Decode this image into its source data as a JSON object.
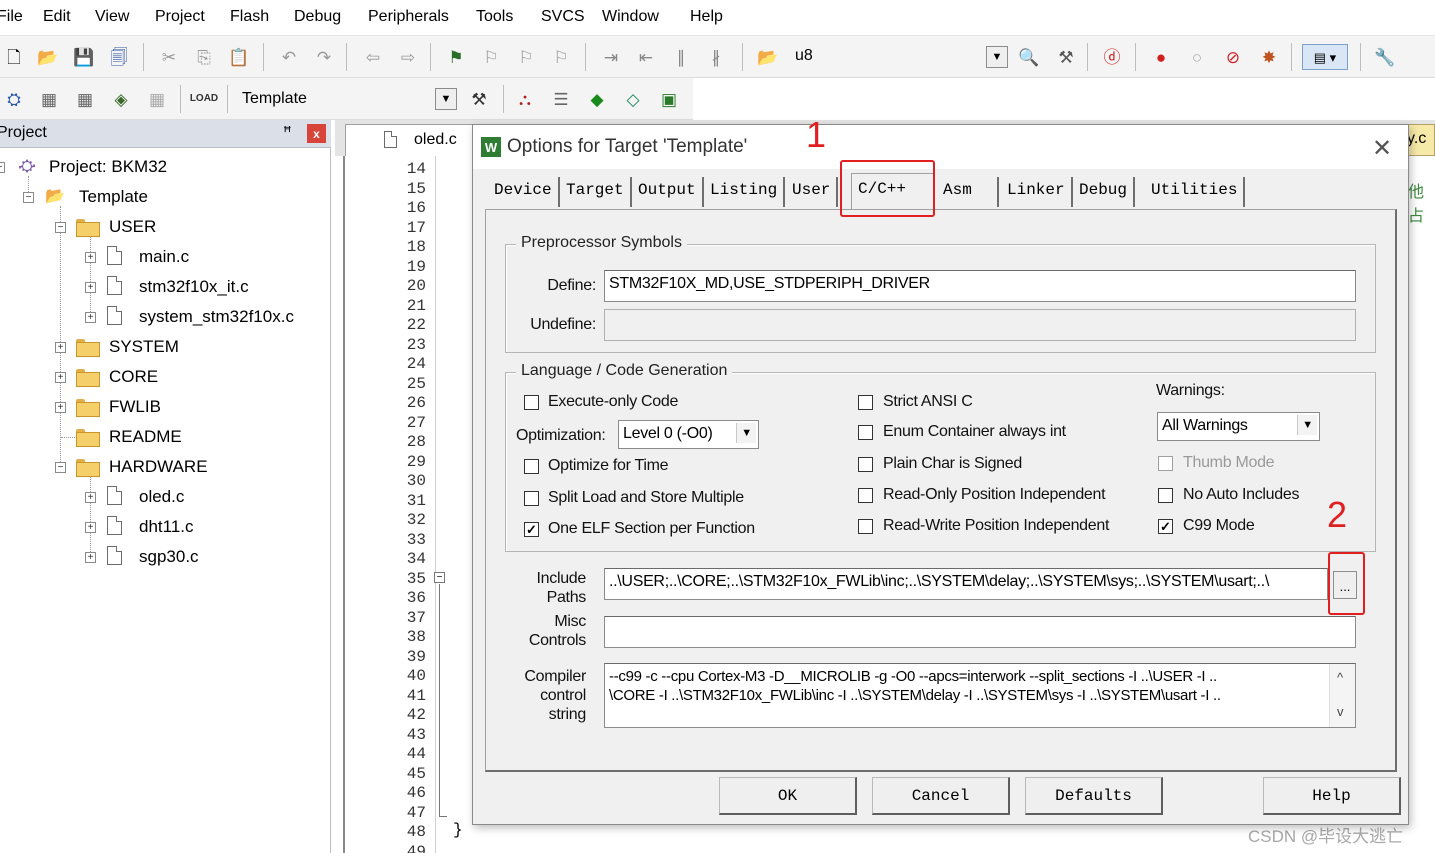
{
  "menu": [
    "File",
    "Edit",
    "View",
    "Project",
    "Flash",
    "Debug",
    "Peripherals",
    "Tools",
    "SVCS",
    "Window",
    "Help"
  ],
  "toolbar1": {
    "target_combo_value": "u8"
  },
  "toolbar2": {
    "target_name": "Template"
  },
  "project_panel": {
    "title": "Project",
    "pin_glyph": "ꟸ",
    "close_glyph": "x",
    "root": "Project: BKM32",
    "target": "Template",
    "groups": {
      "user": "USER",
      "system": "SYSTEM",
      "core": "CORE",
      "fwlib": "FWLIB",
      "readme": "README",
      "hardware": "HARDWARE"
    },
    "user_files": [
      "main.c",
      "stm32f10x_it.c",
      "system_stm32f10x.c"
    ],
    "hardware_files": [
      "oled.c",
      "dht11.c",
      "sgp30.c"
    ]
  },
  "editor": {
    "active_tab": "oled.c",
    "right_tab_fragment": "y.c",
    "right_text_fragment": "他占",
    "line_numbers": [
      "14",
      "15",
      "16",
      "17",
      "18",
      "19",
      "20",
      "21",
      "22",
      "23",
      "24",
      "25",
      "26",
      "27",
      "28",
      "29",
      "30",
      "31",
      "32",
      "33",
      "34",
      "35",
      "36",
      "37",
      "38",
      "39",
      "40",
      "41",
      "42",
      "43",
      "44",
      "45",
      "46",
      "47",
      "48",
      "49"
    ],
    "closing_brace": "}",
    "fold_glyph": "−"
  },
  "dialog": {
    "app_icon": "W",
    "title": "Options for Target 'Template'",
    "close_glyph": "✕",
    "tabs": [
      "Device",
      "Target",
      "Output",
      "Listing",
      "User",
      "C/C++",
      "Asm",
      "Linker",
      "Debug",
      "Utilities"
    ],
    "active_tab": "C/C++",
    "preprocessor": {
      "caption": "Preprocessor Symbols",
      "define_label": "Define:",
      "define_value": "STM32F10X_MD,USE_STDPERIPH_DRIVER",
      "undefine_label": "Undefine:",
      "undefine_value": ""
    },
    "codegen": {
      "caption": "Language / Code Generation",
      "execute_only": {
        "label": "Execute-only Code",
        "checked": false
      },
      "optimization_label": "Optimization:",
      "optimization_value": "Level 0 (-O0)",
      "optimize_time": {
        "label": "Optimize for Time",
        "checked": false
      },
      "split_load": {
        "label": "Split Load and Store Multiple",
        "checked": false
      },
      "one_elf": {
        "label": "One ELF Section per Function",
        "checked": true
      },
      "strict_ansi": {
        "label": "Strict ANSI C",
        "checked": false
      },
      "enum_container": {
        "label": "Enum Container always int",
        "checked": false
      },
      "plain_char": {
        "label": "Plain Char is Signed",
        "checked": false
      },
      "ro_pi": {
        "label": "Read-Only Position Independent",
        "checked": false
      },
      "rw_pi": {
        "label": "Read-Write Position Independent",
        "checked": false
      },
      "warnings_label": "Warnings:",
      "warnings_value": "All Warnings",
      "thumb_mode": {
        "label": "Thumb Mode",
        "checked": false
      },
      "no_auto_includes": {
        "label": "No Auto Includes",
        "checked": false
      },
      "c99_mode": {
        "label": "C99 Mode",
        "checked": true
      }
    },
    "include_paths": {
      "label_line1": "Include",
      "label_line2": "Paths",
      "value": "..\\USER;..\\CORE;..\\STM32F10x_FWLib\\inc;..\\SYSTEM\\delay;..\\SYSTEM\\sys;..\\SYSTEM\\usart;..\\",
      "browse": "..."
    },
    "misc_controls": {
      "label_line1": "Misc",
      "label_line2": "Controls",
      "value": ""
    },
    "compiler_string": {
      "label_line1": "Compiler",
      "label_line2": "control",
      "label_line3": "string",
      "line1": "--c99 -c --cpu Cortex-M3 -D__MICROLIB -g -O0 --apcs=interwork --split_sections -I ..\\USER -I ..",
      "line2": "\\CORE -I ..\\STM32F10x_FWLib\\inc -I ..\\SYSTEM\\delay -I ..\\SYSTEM\\sys -I ..\\SYSTEM\\usart -I .."
    },
    "buttons": {
      "ok": "OK",
      "cancel": "Cancel",
      "defaults": "Defaults",
      "help": "Help"
    }
  },
  "annotations": {
    "one": "1",
    "two": "2"
  },
  "watermark": "CSDN @毕设大逃亡",
  "colors": {
    "annotation_red": "#e02020",
    "dialog_bg": "#f0f0f0",
    "panel_header": "#dadfe8"
  }
}
